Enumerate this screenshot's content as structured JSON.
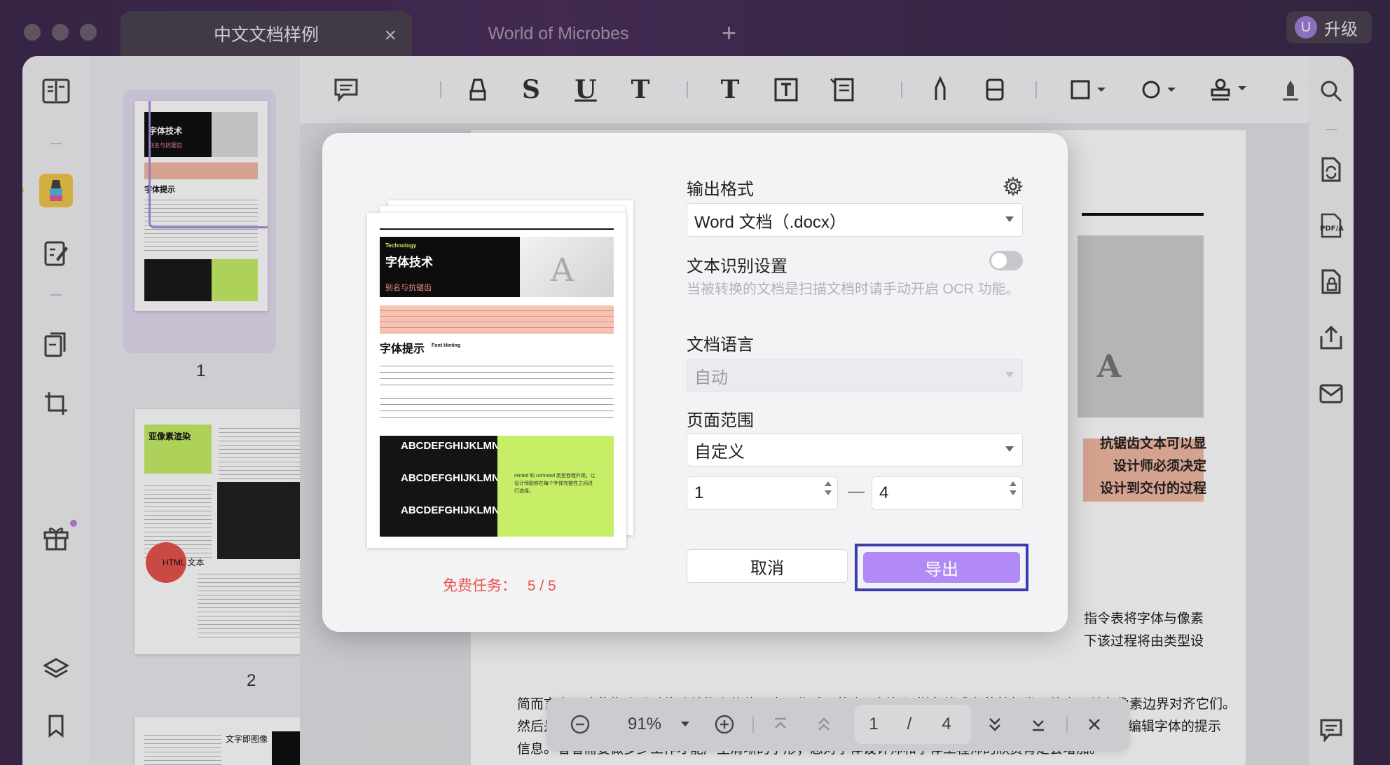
{
  "titlebar": {
    "tabs": [
      {
        "label": "中文文档样例",
        "active": true
      },
      {
        "label": "World of Microbes",
        "active": false
      }
    ],
    "upgrade_label": "升级",
    "avatar_letter": "U"
  },
  "thumbnails": {
    "pages": [
      {
        "number": "1",
        "title": "字体技术",
        "subtitle": "别名与抗锯齿",
        "section": "字体提示"
      },
      {
        "number": "2",
        "title": "亚像素渲染",
        "section": "HTML 文本"
      },
      {
        "number": "3",
        "section": "文字即图像"
      }
    ]
  },
  "document": {
    "right_snippets": [
      "抗锯齿文本可以显",
      "设计师必须决定",
      "设计到交付的过程",
      "指令表将字体与像素",
      "下该过程将由类型设"
    ],
    "paragraph_lines": [
      "简而言之，这些指令通过修改结构上的位置来工作重要的点，例如沿样条线或在茎基部发现的点，并在像素边界对齐它们。",
      "然后是中间点根据它们与主要点的关系重新定位。使用开源字体编辑器，例如 FontForge，允许您查看和编辑字体的提示",
      "信息。看看需要做多少工作才能产生清晰的字形；您对字体设计师和字体工程师的欣赏肯定会增加。"
    ]
  },
  "zoombar": {
    "zoom": "91%",
    "current_page": "1",
    "separator": "/",
    "total_pages": "4"
  },
  "dialog": {
    "preview": {
      "tag": "Technology",
      "title": "字体技术",
      "subtitle": "别名与抗锯齿",
      "section": "字体提示",
      "section_en": "Font Hinting",
      "sample_letters": "ABCDEFGHIJKLMNO",
      "green_note": "Hinted 和 unhinted 类型吞噬外观，让设计师能够在每个字体完整性之间进行选择。"
    },
    "free_task_label": "免费任务：",
    "free_task_count": "5 / 5",
    "output_format_label": "输出格式",
    "output_format_value": "Word 文档（.docx）",
    "ocr_label": "文本识别设置",
    "ocr_enabled": false,
    "ocr_hint": "当被转换的文档是扫描文档时请手动开启 OCR 功能。",
    "language_label": "文档语言",
    "language_value": "自动",
    "range_label": "页面范围",
    "range_value": "自定义",
    "range_from": "1",
    "range_dash": "—",
    "range_to": "4",
    "cancel_label": "取消",
    "export_label": "导出"
  },
  "colors": {
    "accent": "#b18af5",
    "focus_ring": "#3c3cb0",
    "free_task": "#e8544d",
    "highlight": "#f4b9a4",
    "green_block": "#c6ee67"
  }
}
